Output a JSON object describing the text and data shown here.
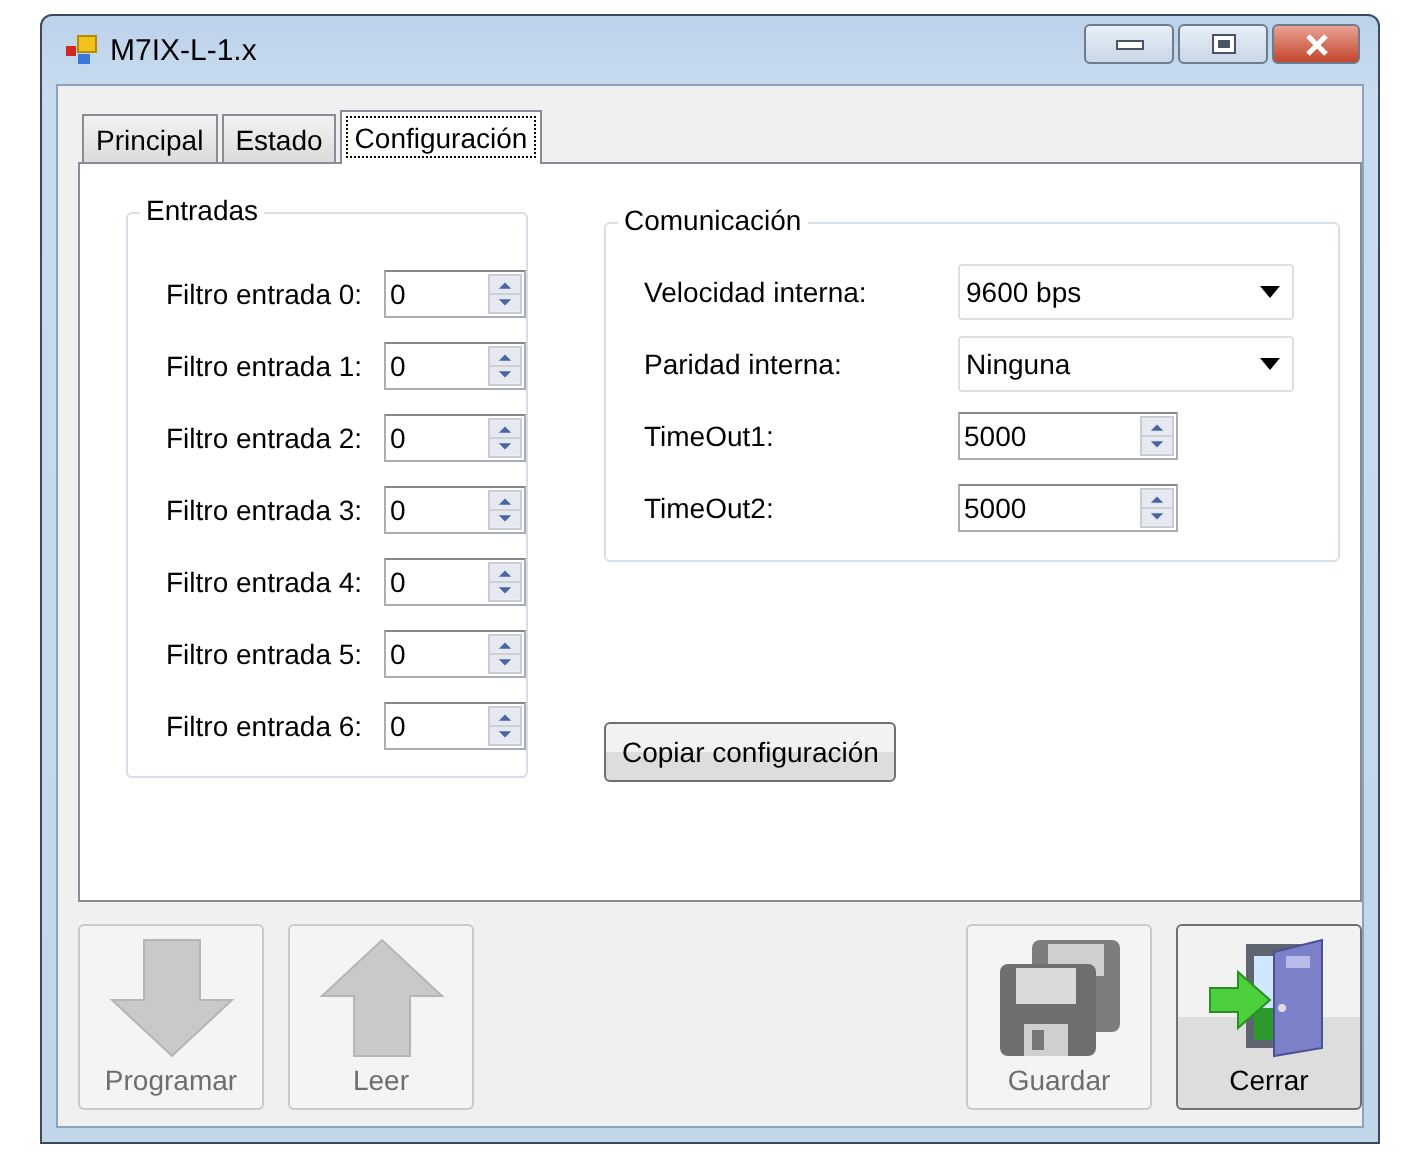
{
  "window": {
    "title": "M7IX-L-1.x"
  },
  "tabs": [
    {
      "label": "Principal",
      "selected": false
    },
    {
      "label": "Estado",
      "selected": false
    },
    {
      "label": "Configuración",
      "selected": true
    }
  ],
  "inputs_group": {
    "title": "Entradas",
    "rows": [
      {
        "label": "Filtro entrada 0:",
        "value": "0"
      },
      {
        "label": "Filtro entrada 1:",
        "value": "0"
      },
      {
        "label": "Filtro entrada 2:",
        "value": "0"
      },
      {
        "label": "Filtro entrada 3:",
        "value": "0"
      },
      {
        "label": "Filtro entrada 4:",
        "value": "0"
      },
      {
        "label": "Filtro entrada 5:",
        "value": "0"
      },
      {
        "label": "Filtro entrada 6:",
        "value": "0"
      }
    ]
  },
  "comm_group": {
    "title": "Comunicación",
    "rows": [
      {
        "kind": "combo",
        "label": "Velocidad interna:",
        "value": "9600 bps"
      },
      {
        "kind": "combo",
        "label": "Paridad interna:",
        "value": "Ninguna"
      },
      {
        "kind": "spin",
        "label": "TimeOut1:",
        "value": "5000"
      },
      {
        "kind": "spin",
        "label": "TimeOut2:",
        "value": "5000"
      }
    ]
  },
  "copy_button": {
    "label": "Copiar configuración"
  },
  "actions": [
    {
      "kind": "download",
      "label": "Programar",
      "disabled": true
    },
    {
      "kind": "upload",
      "label": "Leer",
      "disabled": true
    },
    {
      "kind": "save",
      "label": "Guardar",
      "disabled": true
    },
    {
      "kind": "exit",
      "label": "Cerrar",
      "disabled": false
    }
  ]
}
